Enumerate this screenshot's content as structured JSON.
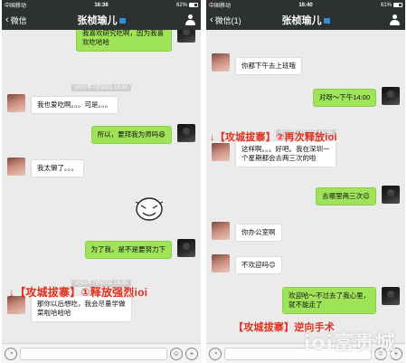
{
  "left": {
    "status": {
      "carrier": "中国移动",
      "time": "16:36",
      "battery": "62%"
    },
    "nav": {
      "back": "微信",
      "title": "张桢瑜儿"
    },
    "messages": [
      {
        "side": "right",
        "text": "我喜欢研究吃啊，因为我喜欢吃哈哈"
      },
      {
        "side": "ts",
        "text": "2015年7月23日 16:33"
      },
      {
        "side": "left",
        "text": "我也爱吃啊。。。可是。。。"
      },
      {
        "side": "right",
        "text": "所以，要拜我为师吗😄"
      },
      {
        "side": "left",
        "text": "我太懒了。。。"
      },
      {
        "side": "right",
        "text": "为了我，是不是要努力下"
      },
      {
        "side": "ts",
        "text": "2015年7月23日 16:35"
      },
      {
        "side": "left",
        "text": "那你以后想吃，我会尽量学做菜啦哈哈哈"
      }
    ],
    "annotation": "↓【攻城拔寨】①释放强烈ioi"
  },
  "right": {
    "status": {
      "carrier": "中国移动",
      "time": "16:40",
      "battery": "61%"
    },
    "nav": {
      "back": "微信(1)",
      "title": "张桢瑜儿"
    },
    "messages": [
      {
        "side": "left",
        "text": "你都下午去上班哦"
      },
      {
        "side": "right",
        "text": "对呀～下午14:00"
      },
      {
        "side": "ts",
        "text": "2015年7月23日 16:38"
      },
      {
        "side": "left",
        "text": "这样啊。。。好吧。我在深圳一个星期都会去两三次的啦"
      },
      {
        "side": "right",
        "text": "去哪里两三次😉"
      },
      {
        "side": "left",
        "text": "你办公室啊"
      },
      {
        "side": "left",
        "text": "不欢迎吗😊"
      },
      {
        "side": "right",
        "text": "欢迎哈～不过去了我心里，就不能走了"
      }
    ],
    "annotation1": "↓【攻城拔寨】②再次释放ioi",
    "annotation2": "【攻城拔寨】逆向手术",
    "watermark": "ioi富贵城",
    "watermark_sub": "Baidu经验"
  }
}
